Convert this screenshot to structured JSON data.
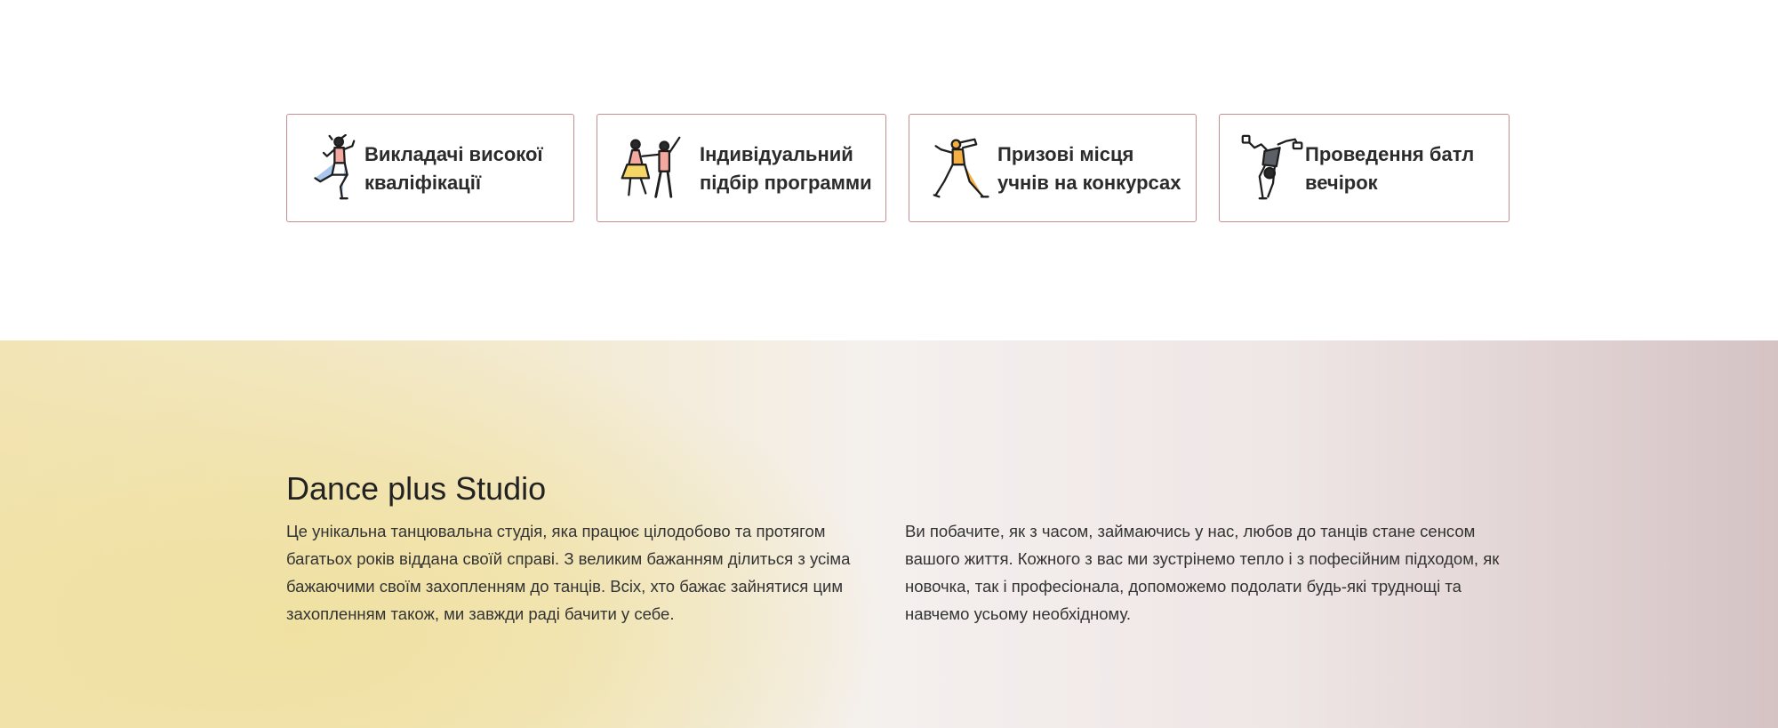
{
  "features": [
    {
      "icon": "dancer-woman-icon",
      "label": "Викладачі високої\nкваліфікації"
    },
    {
      "icon": "dance-couple-icon",
      "label": "Індивідуальний\nпідбір программи"
    },
    {
      "icon": "dancer-leap-icon",
      "label": "Призові місця\nучнів на конкурсах"
    },
    {
      "icon": "breakdancer-icon",
      "label": "Проведення батл\nвечірок"
    }
  ],
  "about": {
    "title": "Dance plus Studio",
    "col1": "Це унікальна танцювальна студія, яка працює цілодобово та протягом багатьох років віддана своїй справі. З великим бажанням ділиться з усіма бажаючими своїм захопленням до танців. Всіх, хто бажає зайнятися цим захопленням також, ми завжди раді бачити у себе.",
    "col2": "Ви побачите, як з часом, займаючись у нас, любов до танців стане сенсом вашого життя. Кожного з вас ми зустрінемо тепло і з пофесійним підходом, як новочка, так і професіонала, допоможемо подолати будь-які труднощі та навчемо усьому необхідному."
  },
  "colors": {
    "card_border": "#c48f93",
    "gradient_left": "#f2e4b4",
    "gradient_right": "#d5c3c4"
  }
}
